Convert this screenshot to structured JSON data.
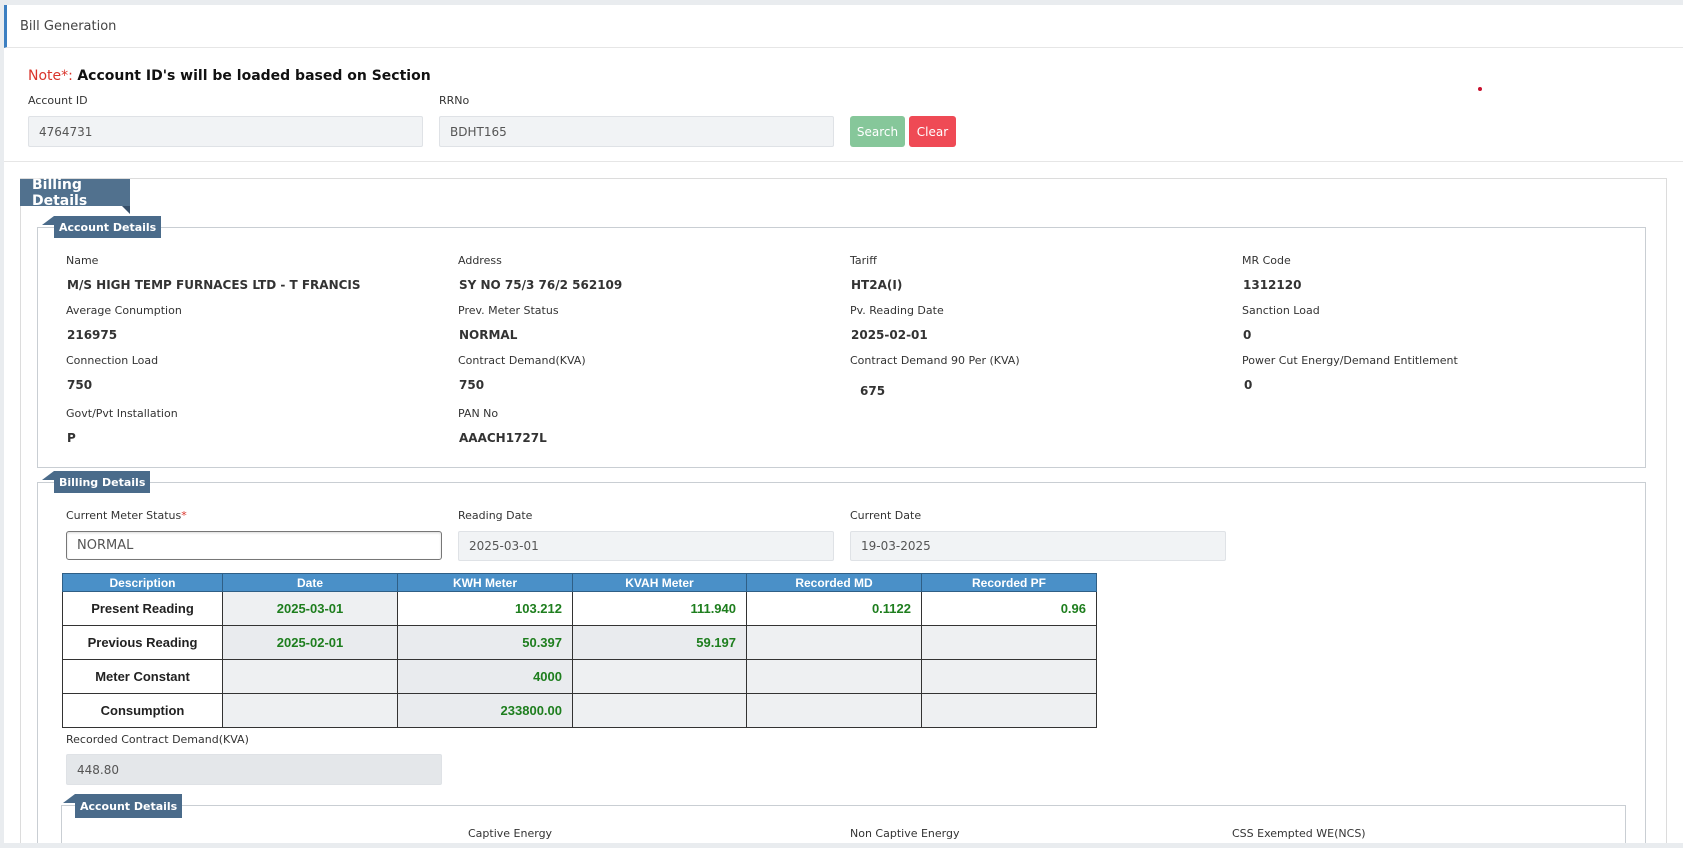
{
  "page": {
    "title": "Bill Generation"
  },
  "note": {
    "label": "Note*:",
    "text": "Account ID's will be loaded based on Section"
  },
  "search": {
    "account_id_label": "Account ID",
    "account_id_value": "4764731",
    "rrno_label": "RRNo",
    "rrno_value": "BDHT165",
    "search_label": "Search",
    "clear_label": "Clear"
  },
  "billing_section_title": "Billing Details",
  "account_details": {
    "title": "Account Details",
    "fields": [
      {
        "label": "Name",
        "value": "M/S HIGH TEMP FURNACES LTD - T FRANCIS"
      },
      {
        "label": "Address",
        "value": "SY NO 75/3 76/2 562109"
      },
      {
        "label": "Tariff",
        "value": "HT2A(I)"
      },
      {
        "label": "MR Code",
        "value": "1312120"
      },
      {
        "label": "Average Conumption",
        "value": "216975"
      },
      {
        "label": "Prev. Meter Status",
        "value": "NORMAL"
      },
      {
        "label": "Pv. Reading Date",
        "value": "2025-02-01"
      },
      {
        "label": "Sanction Load",
        "value": "0"
      },
      {
        "label": "Connection Load",
        "value": "750"
      },
      {
        "label": "Contract Demand(KVA)",
        "value": "750"
      },
      {
        "label": "Contract Demand 90 Per (KVA)",
        "value": "675"
      },
      {
        "label": "Power Cut Energy/Demand Entitlement",
        "value": "0"
      },
      {
        "label": "Govt/Pvt Installation",
        "value": "P"
      },
      {
        "label": "PAN No",
        "value": "AAACH1727L"
      }
    ]
  },
  "billing_details": {
    "title": "Billing Details",
    "current_meter_status_label": "Current Meter Status",
    "required_mark": "*",
    "current_meter_status_value": "NORMAL",
    "reading_date_label": "Reading Date",
    "reading_date_value": "2025-03-01",
    "current_date_label": "Current Date",
    "current_date_value": "19-03-2025",
    "table": {
      "headers": [
        "Description",
        "Date",
        "KWH Meter",
        "KVAH Meter",
        "Recorded MD",
        "Recorded PF"
      ],
      "rows": [
        [
          "Present Reading",
          "2025-03-01",
          "103.212",
          "111.940",
          "0.1122",
          "0.96"
        ],
        [
          "Previous Reading",
          "2025-02-01",
          "50.397",
          "59.197",
          "",
          ""
        ],
        [
          "Meter Constant",
          "",
          "4000",
          "",
          "",
          ""
        ],
        [
          "Consumption",
          "",
          "233800.00",
          "",
          "",
          ""
        ]
      ]
    },
    "recorded_cd_label": "Recorded Contract Demand(KVA)",
    "recorded_cd_value": "448.80"
  },
  "account_details_2": {
    "title": "Account Details",
    "labels": [
      "Captive Energy",
      "Non Captive Energy",
      "CSS Exempted WE(NCS)"
    ]
  }
}
